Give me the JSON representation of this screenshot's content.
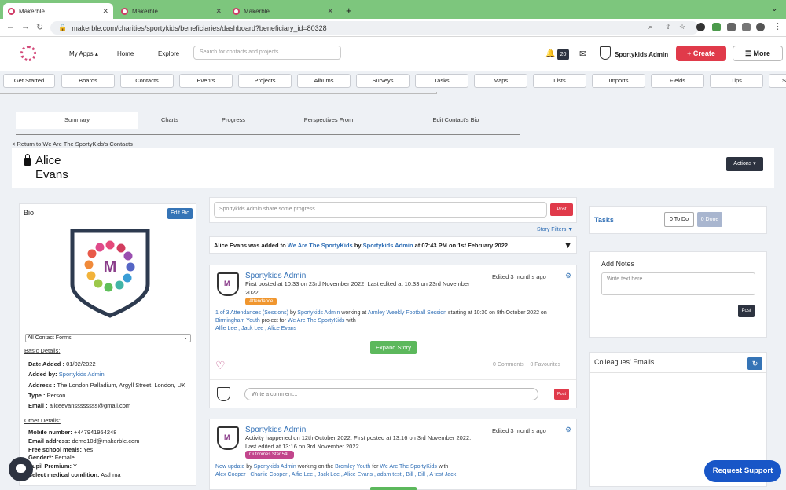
{
  "browser": {
    "tabs": [
      {
        "title": "Makerble"
      },
      {
        "title": "Makerble"
      },
      {
        "title": "Makerble"
      }
    ],
    "new_tab_icon": "plus-icon",
    "url": "makerble.com/charities/sportykids/beneficiaries/dashboard?beneficiary_id=80328"
  },
  "header": {
    "my_apps": "My Apps ▴",
    "home": "Home",
    "explore": "Explore",
    "search_placeholder": "Search for contacts and projects",
    "notifications_count": "20",
    "user": "Sportykids Admin",
    "create": "+ Create",
    "more": "☰ More"
  },
  "modules": [
    "Get Started",
    "Boards",
    "Contacts",
    "Events",
    "Projects",
    "Albums",
    "Surveys",
    "Tasks",
    "Maps",
    "Lists",
    "Imports",
    "Fields",
    "Tips",
    "S"
  ],
  "subtabs": [
    "Summary",
    "Charts",
    "Progress",
    "Perspectives From",
    "Edit Contact's Bio"
  ],
  "back_link": "< Return to We Are The SportyKids's Contacts",
  "contact": {
    "first_name": "Alice",
    "last_name": "Evans",
    "actions": "Actions ▾"
  },
  "bio": {
    "title": "Bio",
    "edit_label": "Edit Bio",
    "form_select": "All Contact Forms",
    "basic_heading": "Basic Details:",
    "basic": [
      {
        "label": "Date Added :",
        "value": "01/02/2022"
      },
      {
        "label": "Added by:",
        "value": "Sportykids Admin"
      },
      {
        "label": "Address :",
        "value": "The London Palladium, Argyll Street, London, UK"
      },
      {
        "label": "Type :",
        "value": "Person"
      },
      {
        "label": "Email :",
        "value": "aliceevanssssssss@gmail.com"
      }
    ],
    "other_heading": "Other Details:",
    "other": [
      {
        "label": "Mobile number:",
        "value": "+447941954248"
      },
      {
        "label": "Email address:",
        "value": "demo10d@makerble.com"
      },
      {
        "label": "Free school meals:",
        "value": "Yes"
      },
      {
        "label": "Gender*:",
        "value": "Female"
      },
      {
        "label": "Pupil Premium:",
        "value": "Y"
      },
      {
        "label": "Select medical condition:",
        "value": "Asthma"
      }
    ]
  },
  "feed": {
    "post_placeholder": "Sportykids Admin share some progress",
    "post_label": "Post",
    "story_filters": "Story Filters ▼",
    "added_banner": {
      "prefix": "Alice Evans was added to ",
      "group": "We Are The SportyKids",
      "by": " by ",
      "user": "Sportykids Admin",
      "suffix": " at 07:43 PM on 1st February 2022"
    },
    "stories": [
      {
        "author": "Sportykids Admin",
        "line1": "First posted at 10:33 on 23rd November 2022. Last edited at 10:33 on 23rd November",
        "line2": "2022",
        "edited": "Edited 3 months ago",
        "tag": "Attendance",
        "tag_color": "#f0962e",
        "body_a": "1 of 3 Attendances (Sessions)",
        "body_b": " by ",
        "body_c": "Sportykids Admin",
        "body_d": " working at ",
        "body_e": "Armley Weekly Football Session",
        "body_f": " starting at 10:30 on 8th October 2022 on",
        "body_g": "Birmingham Youth",
        "body_h": " project for ",
        "body_i": "We Are The SportyKids",
        "body_j": " with",
        "people": "Alfie Lee , Jack Lee , Alice Evans",
        "expand": "Expand Story",
        "comments": "0 Comments",
        "favourites": "0 Favourites",
        "comment_placeholder": "Write a comment...",
        "comment_post": "Post"
      },
      {
        "author": "Sportykids Admin",
        "line1": "Activity happened on 12th October 2022. First posted at 13:16 on 3rd November 2022.",
        "line2": "Last edited at 13:16 on 3rd November 2022",
        "edited": "Edited 3 months ago",
        "tag": "Outcomes Star 54L",
        "tag_color": "#c2458c",
        "body_a": "New update",
        "body_b": " by ",
        "body_c": "Sportykids Admin",
        "body_d": " working on the ",
        "body_e": "Bromley Youth",
        "body_f": " for ",
        "body_g": "We Are The SportyKids",
        "body_h": " with",
        "people": "Alex Cooper , Charlie Cooper , Alfie Lee , Jack Lee , Alice Evans , adam test , Bill , Bill , A test Jack"
      }
    ]
  },
  "tasks": {
    "title": "Tasks",
    "todo": "0 To Do",
    "done": "0 Done"
  },
  "notes": {
    "title": "Add Notes",
    "placeholder": "Write text here...",
    "post": "Post"
  },
  "colleagues": {
    "title": "Colleagues' Emails"
  },
  "support": "Request Support",
  "colors": {
    "accent": "#2f6eb5",
    "create": "#e03a4a",
    "dark": "#2d3340",
    "green": "#5cb85c",
    "tab_green": "#7dc67d"
  }
}
